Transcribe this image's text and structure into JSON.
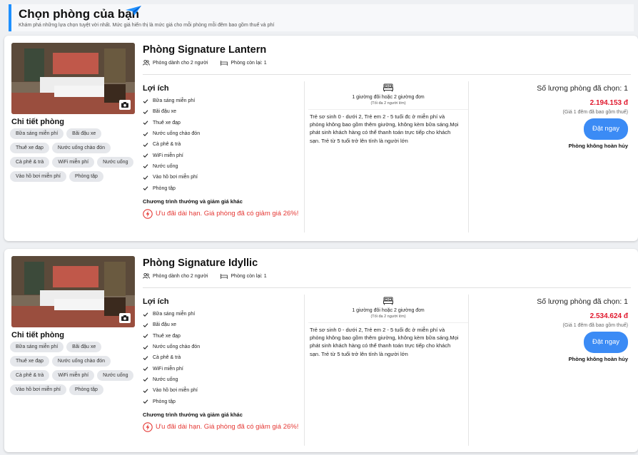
{
  "header": {
    "title": "Chọn phòng của bạn",
    "subtitle": "Khám phá những lựa chọn tuyệt vời nhất. Mức giá hiển thị là mức giá cho mỗi phòng mỗi đêm bao gồm thuế và phí"
  },
  "rooms": [
    {
      "name": "Phòng Signature Lantern",
      "capacity": "Phòng dành cho 2 người",
      "remaining": "Phòng còn lại: 1",
      "detail_title": "Chi tiết phòng",
      "tags": [
        "Bữa sáng miễn phí",
        "Bãi đậu xe",
        "Thuê xe đạp",
        "Nước uống chào đón",
        "Cà phê & trà",
        "WiFi miễn phí",
        "Nước uống",
        "Vào hồ bơi miễn phí",
        "Phòng tập"
      ],
      "benefits_title": "Lợi ích",
      "benefits": [
        "Bữa sáng miễn phí",
        "Bãi đậu xe",
        "Thuê xe đạp",
        "Nước uống chào đón",
        "Cà phê & trà",
        "WiFi miễn phí",
        "Nước uống",
        "Vào hồ bơi miễn phí",
        "Phòng tập"
      ],
      "promo_title": "Chương trình thưởng và giảm giá khác",
      "promo": "Ưu đãi dài hạn. Giá phòng đã có giảm giá 26%!",
      "bed": "1 giường đôi hoặc 2 giường đơn",
      "bed_sub": "(Tối đa 2 người lớn)",
      "policy": "Trẻ sơ sinh 0 - dưới 2, Trẻ em 2 - 5 tuổi đc ở miễn phí và phòng không bao gồm thêm giường, không kèm bữa sáng.Mọi phát sinh khách hàng có thể thanh toán trực tiếp cho khách sạn. Trẻ từ 5 tuổi trở lên tính là người lớn",
      "qty": "Số lượng phòng đã chọn: 1",
      "price": "2.194.153 đ",
      "price_note": "(Giá 1 đêm đã bao gồm thuế)",
      "book": "Đặt ngay",
      "nonrefund": "Phòng không hoàn hủy"
    },
    {
      "name": "Phòng Signature Idyllic",
      "capacity": "Phòng dành cho 2 người",
      "remaining": "Phòng còn lại: 1",
      "detail_title": "Chi tiết phòng",
      "tags": [
        "Bữa sáng miễn phí",
        "Bãi đậu xe",
        "Thuê xe đạp",
        "Nước uống chào đón",
        "Cà phê & trà",
        "WiFi miễn phí",
        "Nước uống",
        "Vào hồ bơi miễn phí",
        "Phòng tập"
      ],
      "benefits_title": "Lợi ích",
      "benefits": [
        "Bữa sáng miễn phí",
        "Bãi đậu xe",
        "Thuê xe đạp",
        "Nước uống chào đón",
        "Cà phê & trà",
        "WiFi miễn phí",
        "Nước uống",
        "Vào hồ bơi miễn phí",
        "Phòng tập"
      ],
      "promo_title": "Chương trình thưởng và giảm giá khác",
      "promo": "Ưu đãi dài hạn. Giá phòng đã có giảm giá 26%!",
      "bed": "1 giường đôi hoặc 2 giường đơn",
      "bed_sub": "(Tối đa 2 người lớn)",
      "policy": "Trẻ sơ sinh 0 - dưới 2, Trẻ em 2 - 5 tuổi đc ở miễn phí và phòng không bao gồm thêm giường, không kèm bữa sáng.Mọi phát sinh khách hàng có thể thanh toán trực tiếp cho khách sạn. Trẻ từ 5 tuổi trở lên tính là người lớn",
      "qty": "Số lượng phòng đã chọn: 1",
      "price": "2.534.624 đ",
      "price_note": "(Giá 1 đêm đã bao gồm thuế)",
      "book": "Đặt ngay",
      "nonrefund": "Phòng không hoàn hủy"
    }
  ],
  "icons": {
    "plane": "paper-plane-icon",
    "people": "people-icon",
    "bed": "bed-icon",
    "check": "check-icon",
    "camera": "camera-icon",
    "promo": "lightning-icon"
  },
  "colors": {
    "accent": "#1e90ff",
    "button": "#3b8bf5",
    "price": "#e0182d",
    "promo": "#e53935"
  }
}
